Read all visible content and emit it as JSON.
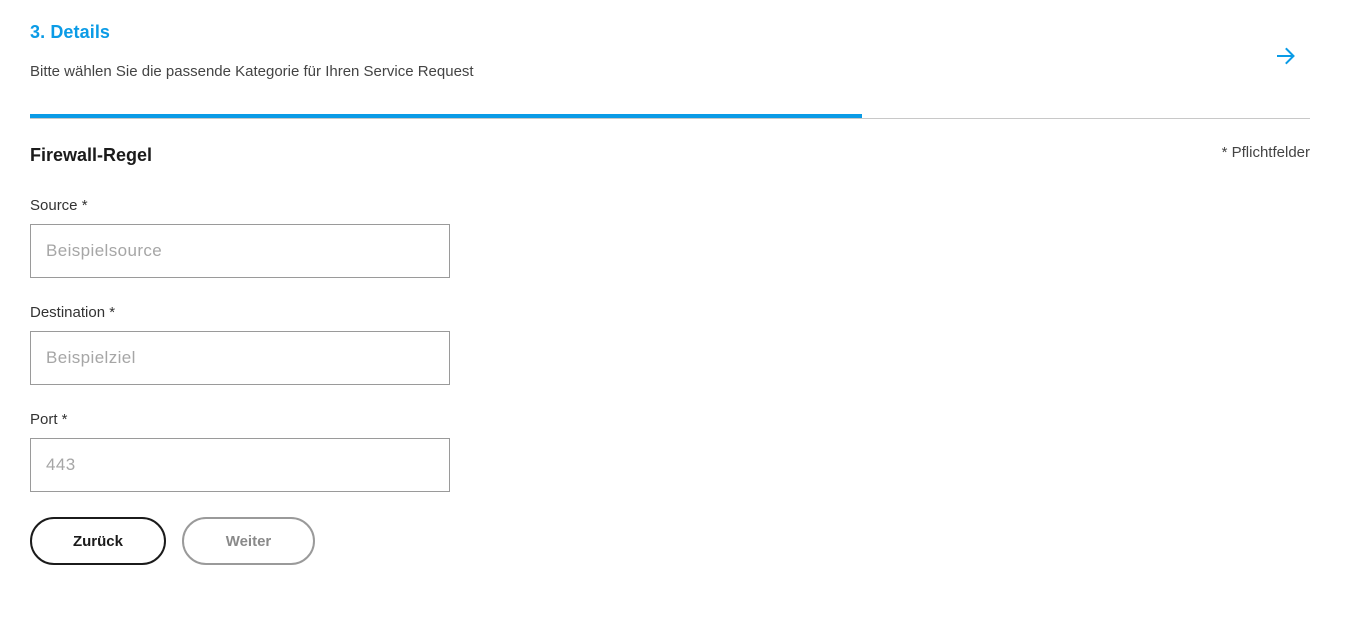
{
  "step": {
    "title": "3. Details",
    "subtitle": "Bitte wählen Sie die passende Kategorie für Ihren Service Request",
    "progress_fraction": 0.65
  },
  "form": {
    "section_title": "Firewall-Regel",
    "required_note": "* Pflichtfelder",
    "fields": [
      {
        "label": "Source *",
        "value": "",
        "placeholder": "Beispielsource"
      },
      {
        "label": "Destination *",
        "value": "",
        "placeholder": "Beispielziel"
      },
      {
        "label": "Port *",
        "value": "",
        "placeholder": "443"
      }
    ]
  },
  "buttons": {
    "back_label": "Zurück",
    "next_label": "Weiter"
  },
  "icons": {
    "next": "arrow-right-icon"
  },
  "colors": {
    "accent": "#0a9be6",
    "disabled": "#9a9a9a",
    "text_dark": "#1b1b1b"
  }
}
